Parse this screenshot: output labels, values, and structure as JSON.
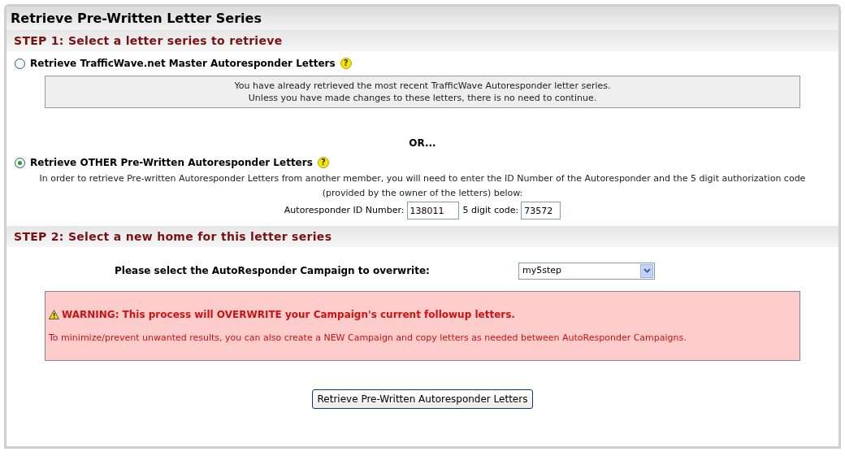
{
  "title": "Retrieve Pre-Written Letter Series",
  "step1": {
    "heading": "STEP 1: Select a letter series to retrieve",
    "option_master": {
      "label": "Retrieve TrafficWave.net Master Autoresponder Letters",
      "selected": false,
      "help": "?"
    },
    "notice": [
      "You have already retrieved the most recent TrafficWave Autoresponder letter series.",
      "Unless you have made changes to these letters, there is no need to continue."
    ],
    "separator": "OR...",
    "option_other": {
      "label": "Retrieve OTHER Pre-Written Autoresponder Letters",
      "selected": true,
      "help": "?",
      "description": "In order to retrieve Pre-written Autoresponder Letters from another member, you will need to enter the ID Number of the Autoresponder and the 5 digit authorization code (provided by the owner of the letters) below:",
      "fields": [
        {
          "label": "Autoresponder ID Number:",
          "value": "138011"
        },
        {
          "label": "5 digit code:",
          "value": "73572"
        }
      ]
    }
  },
  "step2": {
    "heading": "STEP 2: Select a new home for this letter series",
    "campaign_label": "Please select the AutoResponder Campaign to overwrite:",
    "campaign_value": "my5step",
    "warning": {
      "title": "WARNING: This process will OVERWRITE your Campaign's current followup letters.",
      "text": "To minimize/prevent unwanted results, you can also create a NEW Campaign and copy letters as needed between AutoResponder Campaigns."
    }
  },
  "submit_button": "Retrieve Pre-Written Autoresponder Letters"
}
